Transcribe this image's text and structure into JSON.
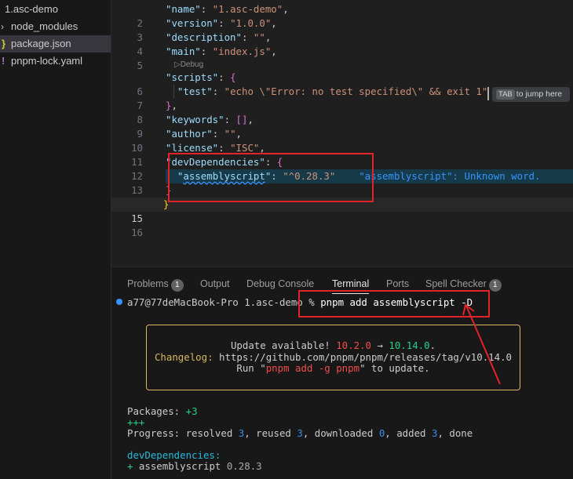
{
  "sidebar": {
    "items": [
      {
        "label": "1.asc-demo",
        "type": "folder"
      },
      {
        "label": "node_modules",
        "type": "folder",
        "twist": "›"
      },
      {
        "label": "package.json",
        "type": "json",
        "icon": "}"
      },
      {
        "label": "pnpm-lock.yaml",
        "type": "yaml",
        "icon": "!"
      }
    ]
  },
  "editor": {
    "codelens": "▷Debug",
    "lines": [
      {
        "n": "2",
        "key": "\"name\"",
        "value": "\"1.asc-demo\"",
        "after": ","
      },
      {
        "n": "3",
        "key": "\"version\"",
        "value": "\"1.0.0\"",
        "after": ","
      },
      {
        "n": "4",
        "key": "\"description\"",
        "value": "\"\"",
        "after": ","
      },
      {
        "n": "5",
        "key": "\"main\"",
        "value": "\"index.js\"",
        "after": ","
      },
      {
        "n": "6",
        "key": "\"scripts\"",
        "open": "{"
      },
      {
        "n": "7",
        "key": "\"test\"",
        "value": "\"echo \\\"Error: no test specified\\\" && exit 1\""
      },
      {
        "n": "8",
        "close": "}",
        "after": ","
      },
      {
        "n": "9",
        "key": "\"keywords\"",
        "value": "[]",
        "after": ","
      },
      {
        "n": "10",
        "key": "\"author\"",
        "value": "\"\"",
        "after": ","
      },
      {
        "n": "11",
        "key": "\"license\"",
        "value": "\"ISC\"",
        "after": ","
      },
      {
        "n": "12",
        "key": "\"devDependencies\"",
        "open": "{"
      },
      {
        "n": "13",
        "key_word": "assemblyscript",
        "value": "\"^0.28.3\"",
        "diagnostic": "\"assemblyscript\": Unknown word."
      },
      {
        "n": "14",
        "close": "}"
      },
      {
        "n": "15",
        "close": "}"
      },
      {
        "n": "16"
      }
    ],
    "tab_hint": {
      "key": "TAB",
      "text": "to jump here"
    }
  },
  "panel": {
    "tabs": [
      {
        "label": "Problems",
        "badge": "1"
      },
      {
        "label": "Output"
      },
      {
        "label": "Debug Console"
      },
      {
        "label": "Terminal",
        "active": true
      },
      {
        "label": "Ports"
      },
      {
        "label": "Spell Checker",
        "badge": "1"
      }
    ],
    "terminal": {
      "prompt": "a77@77deMacBook-Pro 1.asc-demo % ",
      "command": "pnpm add assemblyscript -D",
      "update": {
        "line1_prefix": "Update available! ",
        "from_version": "10.2.0",
        "arrow": " → ",
        "to_version": "10.14.0",
        "line1_suffix": ".",
        "changelog_label": "Changelog: ",
        "changelog_url": "https://github.com/pnpm/pnpm/releases/tag/v10.14.0",
        "run_prefix": "Run \"",
        "run_cmd": "pnpm add -g pnpm",
        "run_suffix": "\" to update."
      },
      "packages_label": "Packages: ",
      "packages_count": "+3",
      "plus_bar": "+++",
      "progress": {
        "prefix": "Progress: resolved ",
        "resolved": "3",
        "reused_label": ", reused ",
        "reused": "3",
        "downloaded_label": ", downloaded ",
        "downloaded": "0",
        "added_label": ", added ",
        "added": "3",
        "done": ", done"
      },
      "devdeps_label": "devDependencies:",
      "dep_plus": "+ ",
      "dep_name": "assemblyscript ",
      "dep_version": "0.28.3"
    }
  },
  "colors": {
    "highlight_box": "#e0242a",
    "accent": "#3794ff"
  }
}
